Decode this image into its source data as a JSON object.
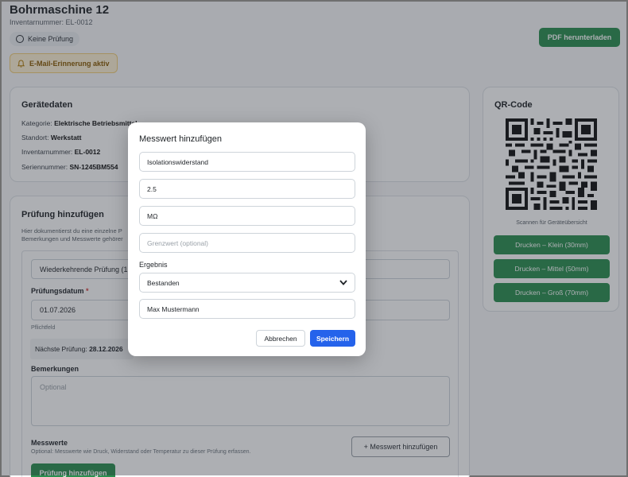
{
  "header": {
    "title": "Bohrmaschine 12",
    "inventory_line": "Inventarnummer: EL-0012",
    "status_label": "Keine Prüfung",
    "email_reminder": "E-Mail-Erinnerung aktiv",
    "pdf_button": "PDF herunterladen"
  },
  "device_card": {
    "title": "Gerätedaten",
    "rows": [
      {
        "label": "Kategorie:",
        "value": "Elektrische Betriebsmittel"
      },
      {
        "label": "Standort:",
        "value": "Werkstatt"
      },
      {
        "label": "Inventarnummer:",
        "value": "EL-0012"
      },
      {
        "label": "Seriennummer:",
        "value": "SN-1245BM554"
      }
    ]
  },
  "qr_card": {
    "title": "QR-Code",
    "caption": "Scannen für Geräteübersicht",
    "print_buttons": [
      "Drucken – Klein (30mm)",
      "Drucken – Mittel (50mm)",
      "Drucken – Groß (70mm)"
    ]
  },
  "inspection_card": {
    "title": "Prüfung hinzufügen",
    "description_line1": "Hier dokumentierst du eine einzelne P",
    "description_line2": "Bemerkungen und Messwerte gehörer",
    "type_select": "Wiederkehrende Prüfung (1",
    "date_label": "Prüfungsdatum",
    "date_required": "*",
    "date_value": "01.07.2026",
    "date_hint": "Pflichtfeld",
    "next_label": "Nächste Prüfung:",
    "next_value": "28.12.2026",
    "remarks_label": "Bemerkungen",
    "remarks_placeholder": "Optional",
    "measurements_label": "Messwerte",
    "measurements_hint": "Optional: Messwerte wie Druck, Widerstand oder Temperatur zu dieser Prüfung erfassen.",
    "add_measurement_button": "+ Messwert hinzufügen",
    "submit_button": "Prüfung hinzufügen"
  },
  "modal": {
    "title": "Messwert hinzufügen",
    "name_value": "Isolationswiderstand",
    "value_value": "2.5",
    "unit_value": "MΩ",
    "limit_placeholder": "Grenzwert (optional)",
    "result_label": "Ergebnis",
    "result_value": "Bestanden",
    "inspector_value": "Max Mustermann",
    "cancel_button": "Abbrechen",
    "save_button": "Speichern"
  },
  "colors": {
    "primary_green": "#2a8f4f",
    "primary_blue": "#2563eb",
    "warning_bg": "#fff3d6"
  }
}
